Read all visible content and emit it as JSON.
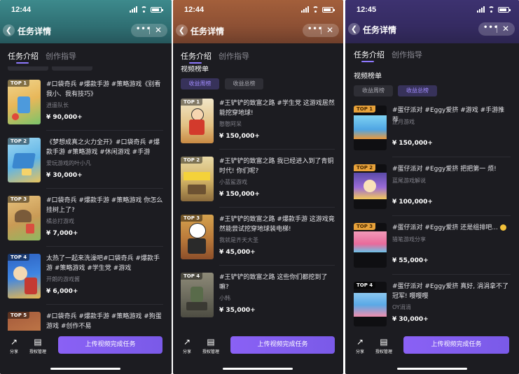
{
  "panels": [
    {
      "time": "12:44",
      "title": "任务详情",
      "tabs": [
        "任务介绍",
        "创作指导"
      ],
      "cards": [
        {
          "rank": "TOP 1",
          "title": "#口袋奇兵 #爆款手游 #策略游戏《别看我小、我有技巧》",
          "author": "逍遥队长",
          "reward": "¥ 90,000+"
        },
        {
          "rank": "TOP 2",
          "title": "《梦想成真之火力全开》#口袋奇兵 #爆款手游 #策略游戏 #休闲游戏 #手游",
          "author": "爱玩游戏的叶小凡",
          "reward": "¥ 30,000+"
        },
        {
          "rank": "TOP 3",
          "title": "#口袋奇兵 #爆款手游 #策略游戏 你怎么挂树上了?",
          "author": "橘总打游戏",
          "reward": "¥ 7,000+"
        },
        {
          "rank": "TOP 4",
          "title": "太热了一起来洗澡吧#口袋奇兵 #爆款手游 #策略游戏 #学生党 #游戏",
          "author": "开朗的游戏酱",
          "reward": "¥ 6,000+"
        },
        {
          "rank": "TOP 5",
          "title": "#口袋奇兵 #爆款手游 #策略游戏 #狗蛋游戏 #创作不易",
          "author": "",
          "reward": ""
        }
      ],
      "bottom": {
        "share": "分享",
        "auth": "授权管理",
        "upload": "上传视频完成任务"
      }
    },
    {
      "time": "12:44",
      "title": "任务详情",
      "tabs": [
        "任务介绍",
        "创作指导"
      ],
      "section": "视频榜单",
      "chips": [
        "收益周榜",
        "收益总榜"
      ],
      "cards": [
        {
          "rank": "TOP 1",
          "title": "#王铲铲的致富之路 #学生党 这游戏居然能挖穿地球!",
          "author": "憨憨阿呆",
          "reward": "¥ 150,000+"
        },
        {
          "rank": "TOP 2",
          "title": "#王铲铲的致富之路 我已经进入到了青铜时代! 你们呢?",
          "author": "小蓝鲨游戏",
          "reward": "¥ 150,000+"
        },
        {
          "rank": "TOP 3",
          "title": "#王铲铲的致富之路 #爆款手游 这游戏竟然能尝试挖穿地球装电梯!",
          "author": "我就是齐天大圣",
          "reward": "¥ 45,000+"
        },
        {
          "rank": "TOP 4",
          "title": "#王铲铲的致富之路 这些你们都挖到了嘛?",
          "author": "小韩",
          "reward": "¥ 35,000+"
        }
      ],
      "bottom": {
        "share": "分享",
        "auth": "授权管理",
        "upload": "上传视频完成任务"
      }
    },
    {
      "time": "12:45",
      "title": "任务详情",
      "tabs": [
        "任务介绍",
        "创作指导"
      ],
      "section": "视频榜单",
      "chips": [
        "收益周榜",
        "收益总榜"
      ],
      "cards": [
        {
          "rank": "TOP 1",
          "title": "#蛋仔派对 #Eggy爱挤 #游戏 #手游推荐",
          "author": "正月游戏",
          "reward": "¥ 150,000+"
        },
        {
          "rank": "TOP 2",
          "title": "#蛋仔派对 #Eggy爱挤 把把第一 烦!",
          "author": "蓝尾游戏解说",
          "reward": "¥ 100,000+"
        },
        {
          "rank": "TOP 3",
          "title": "#蛋仔派对 #Eggy爱挤 还是组排吧...",
          "author": "猎笔游戏分享",
          "reward": "¥ 55,000+"
        },
        {
          "rank": "TOP 4",
          "title": "#蛋仔派对 #Eggy爱挤 真好, 涓涓拿不了冠军! 嘤嘤嘤",
          "author": "OY涓涓",
          "reward": "¥ 30,000+"
        }
      ],
      "bottom": {
        "share": "分享",
        "auth": "授权管理",
        "upload": "上传视频完成任务"
      }
    }
  ],
  "colors": {
    "accent": "#8a61f5",
    "background": "#1c1c21",
    "chip_active": "#a28cff"
  }
}
